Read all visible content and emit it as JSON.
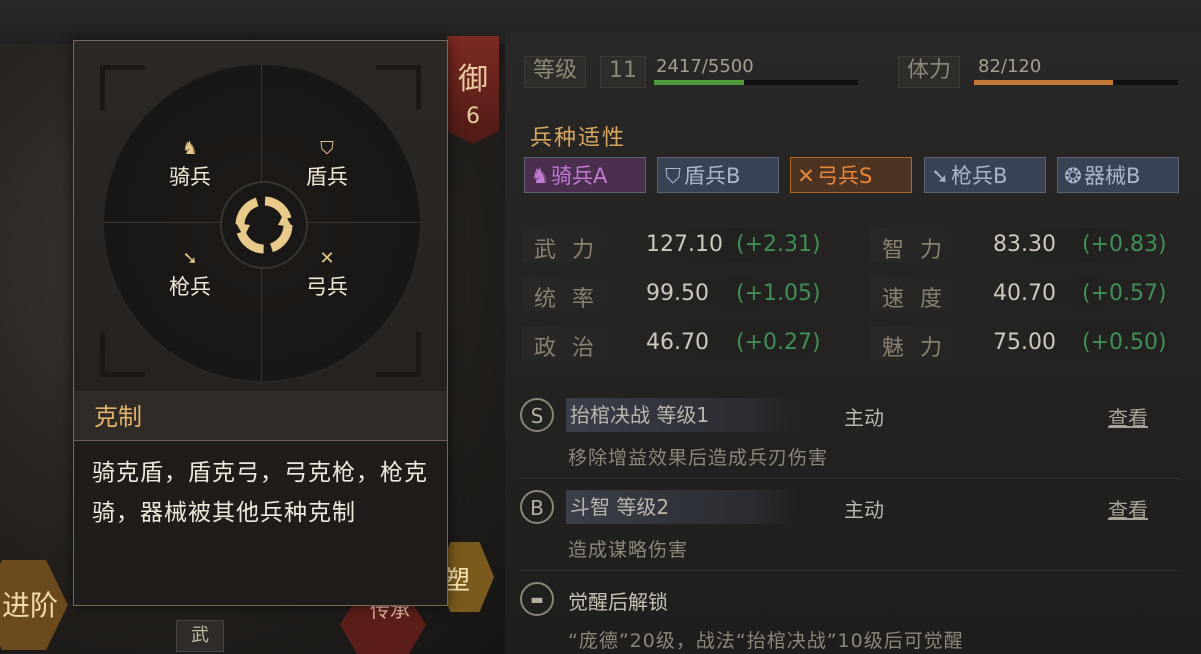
{
  "background": {
    "yu_badge_char": "御",
    "yu_badge_num": "6",
    "advance_label": "进阶",
    "right_hex_label": "塑",
    "chuan_cheng_label": "传承",
    "wu_tag": "武"
  },
  "popup": {
    "units": {
      "cavalry": "骑兵",
      "shield": "盾兵",
      "spear": "枪兵",
      "bow": "弓兵"
    },
    "title": "克制",
    "description": "骑克盾，盾克弓，弓克枪，枪克骑，器械被其他兵种克制"
  },
  "header": {
    "level_label": "等级",
    "level_value": "11",
    "exp_text": "2417/5500",
    "exp_progress": 0.44,
    "stamina_label": "体力",
    "stamina_text": "82/120",
    "stamina_progress": 0.68,
    "exp_color": "#4f9a3a",
    "stamina_color": "#c27a35"
  },
  "affinity": {
    "title": "兵种适性",
    "items": [
      {
        "label": "骑兵A",
        "color": "#c27ad3"
      },
      {
        "label": "盾兵B",
        "color": "#aab5cc"
      },
      {
        "label": "弓兵S",
        "color": "#e8873a"
      },
      {
        "label": "枪兵B",
        "color": "#aab5cc"
      },
      {
        "label": "器械B",
        "color": "#aab5cc"
      }
    ]
  },
  "stats": {
    "wuli": {
      "label": "武力",
      "value": "127.10",
      "bonus": "(+2.31)"
    },
    "zhili": {
      "label": "智力",
      "value": "83.30",
      "bonus": "(+0.83)"
    },
    "tongshuai": {
      "label": "统率",
      "value": "99.50",
      "bonus": "(+1.05)"
    },
    "sudu": {
      "label": "速度",
      "value": "40.70",
      "bonus": "(+0.57)"
    },
    "zhengzhi": {
      "label": "政治",
      "value": "46.70",
      "bonus": "(+0.27)"
    },
    "meili": {
      "label": "魅力",
      "value": "75.00",
      "bonus": "(+0.50)"
    }
  },
  "skills": [
    {
      "grade": "S",
      "name": "抬棺决战 等级1",
      "type": "主动",
      "view": "查看",
      "desc": "移除增益效果后造成兵刃伤害"
    },
    {
      "grade": "B",
      "name": "斗智 等级2",
      "type": "主动",
      "view": "查看",
      "desc": "造成谋略伤害"
    }
  ],
  "awaken": {
    "title": "觉醒后解锁",
    "desc": "“庞德”20级，战法“抬棺决战”10级后可觉醒"
  }
}
